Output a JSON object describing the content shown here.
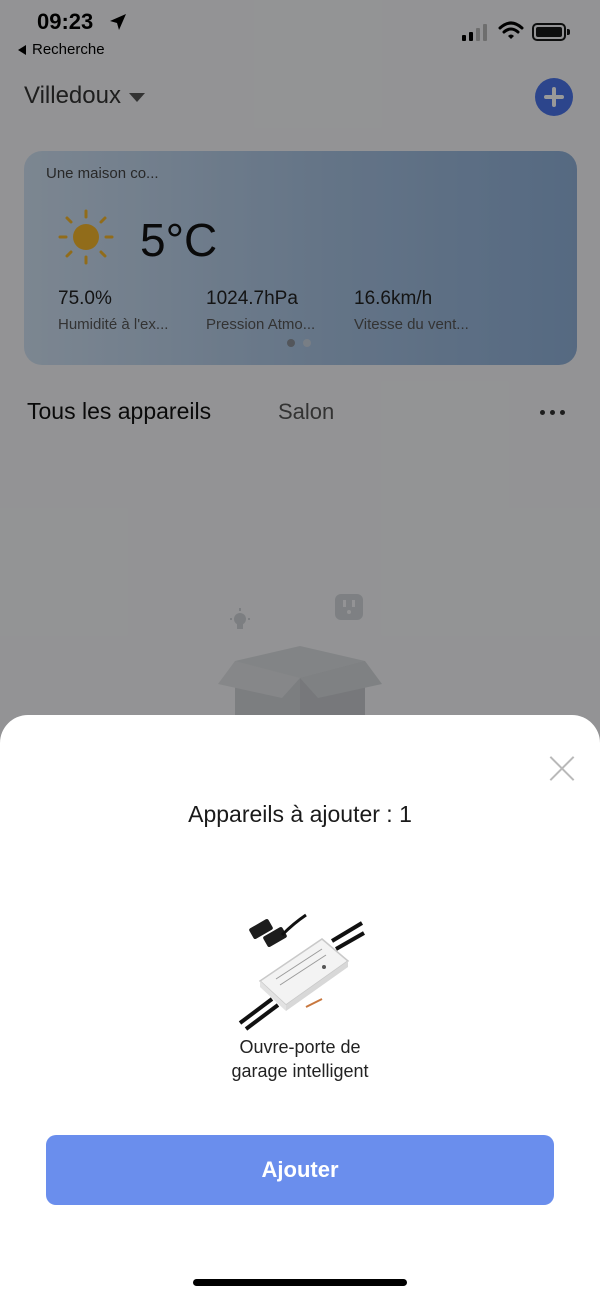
{
  "status_bar": {
    "time": "09:23",
    "back_app": "Recherche"
  },
  "header": {
    "home_name": "Villedoux"
  },
  "weather": {
    "location": "Une maison co...",
    "temperature": "5°C",
    "stats": [
      {
        "value": "75.0%",
        "label": "Humidité à l'ex..."
      },
      {
        "value": "1024.7hPa",
        "label": "Pression Atmo..."
      },
      {
        "value": "16.6km/h",
        "label": "Vitesse du vent..."
      }
    ],
    "page_count": 2,
    "active_page": 1
  },
  "tabs": {
    "all": "Tous les appareils",
    "room": "Salon"
  },
  "sheet": {
    "title": "Appareils à ajouter : 1",
    "device_name_line1": "Ouvre-porte de",
    "device_name_line2": "garage intelligent",
    "add_button": "Ajouter"
  },
  "colors": {
    "accent": "#4a74ea",
    "button": "#6a8eed",
    "weather_sun": "#f2b42c"
  },
  "icons": [
    "location-arrow-icon",
    "back-triangle-icon",
    "signal-icon",
    "wifi-icon",
    "battery-icon",
    "caret-down-icon",
    "plus-icon",
    "sun-icon",
    "more-dots-icon",
    "close-icon",
    "bulb-icon",
    "plug-icon",
    "box-icon"
  ]
}
